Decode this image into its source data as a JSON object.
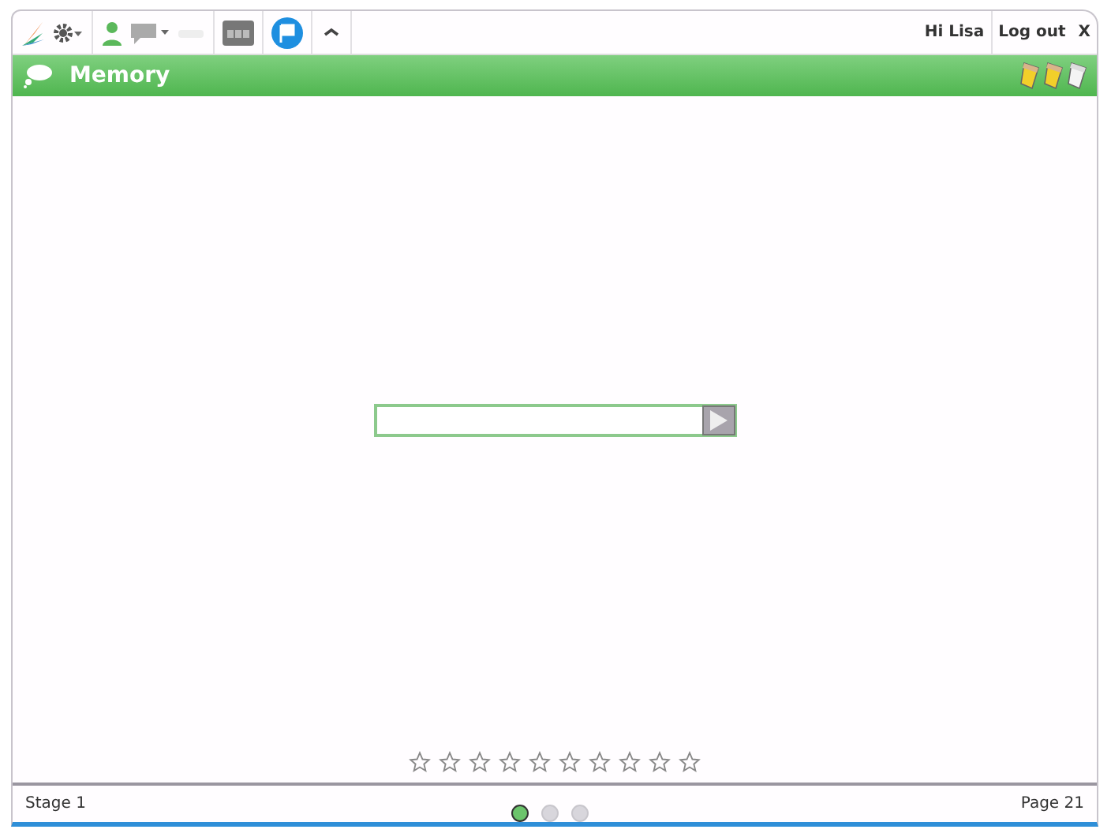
{
  "toolbar": {
    "greeting": "Hi Lisa",
    "logout": "Log out",
    "close": "X"
  },
  "header": {
    "title": "Memory",
    "pencils": [
      {
        "active": true
      },
      {
        "active": true
      },
      {
        "active": false
      }
    ]
  },
  "stars": 0,
  "footer": {
    "stage": "Stage 1",
    "page": "Page 21",
    "dots": [
      {
        "selected": true
      },
      {
        "selected": false
      },
      {
        "selected": false
      }
    ]
  }
}
